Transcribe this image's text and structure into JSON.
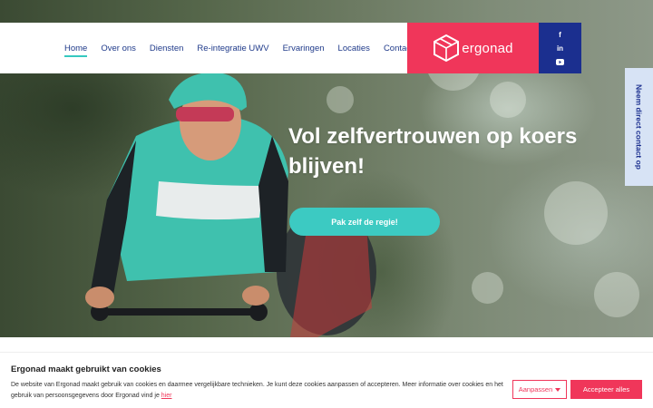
{
  "nav": {
    "items": [
      {
        "label": "Home",
        "active": true
      },
      {
        "label": "Over ons"
      },
      {
        "label": "Diensten"
      },
      {
        "label": "Re-integratie UWV"
      },
      {
        "label": "Ervaringen"
      },
      {
        "label": "Locaties"
      },
      {
        "label": "Contact"
      }
    ]
  },
  "brand": {
    "name": "ergonad",
    "icon": "cube-logo-icon",
    "color": "#f0365a"
  },
  "social": {
    "color": "#1b2f8f",
    "items": [
      {
        "icon": "facebook-icon",
        "glyph": "f"
      },
      {
        "icon": "linkedin-icon",
        "glyph": "in"
      },
      {
        "icon": "youtube-icon",
        "glyph": "▶"
      }
    ]
  },
  "contact_tab": {
    "label": "Neem direct contact op"
  },
  "hero": {
    "headline": "Vol zelfvertrouwen op koers blijven!",
    "cta_label": "Pak zelf de regie!",
    "cta_color": "#3ccac2"
  },
  "cookie": {
    "title": "Ergonad maakt gebruikt van cookies",
    "text": "De website van Ergonad maakt gebruik van cookies en daarmee vergelijkbare technieken. Je kunt deze cookies aanpassen of accepteren. Meer informatie over cookies en het gebruik van persoonsgegevens door Ergonad vind je",
    "link_label": "hier",
    "adjust_label": "Aanpassen",
    "accept_label": "Accepteer alles"
  }
}
